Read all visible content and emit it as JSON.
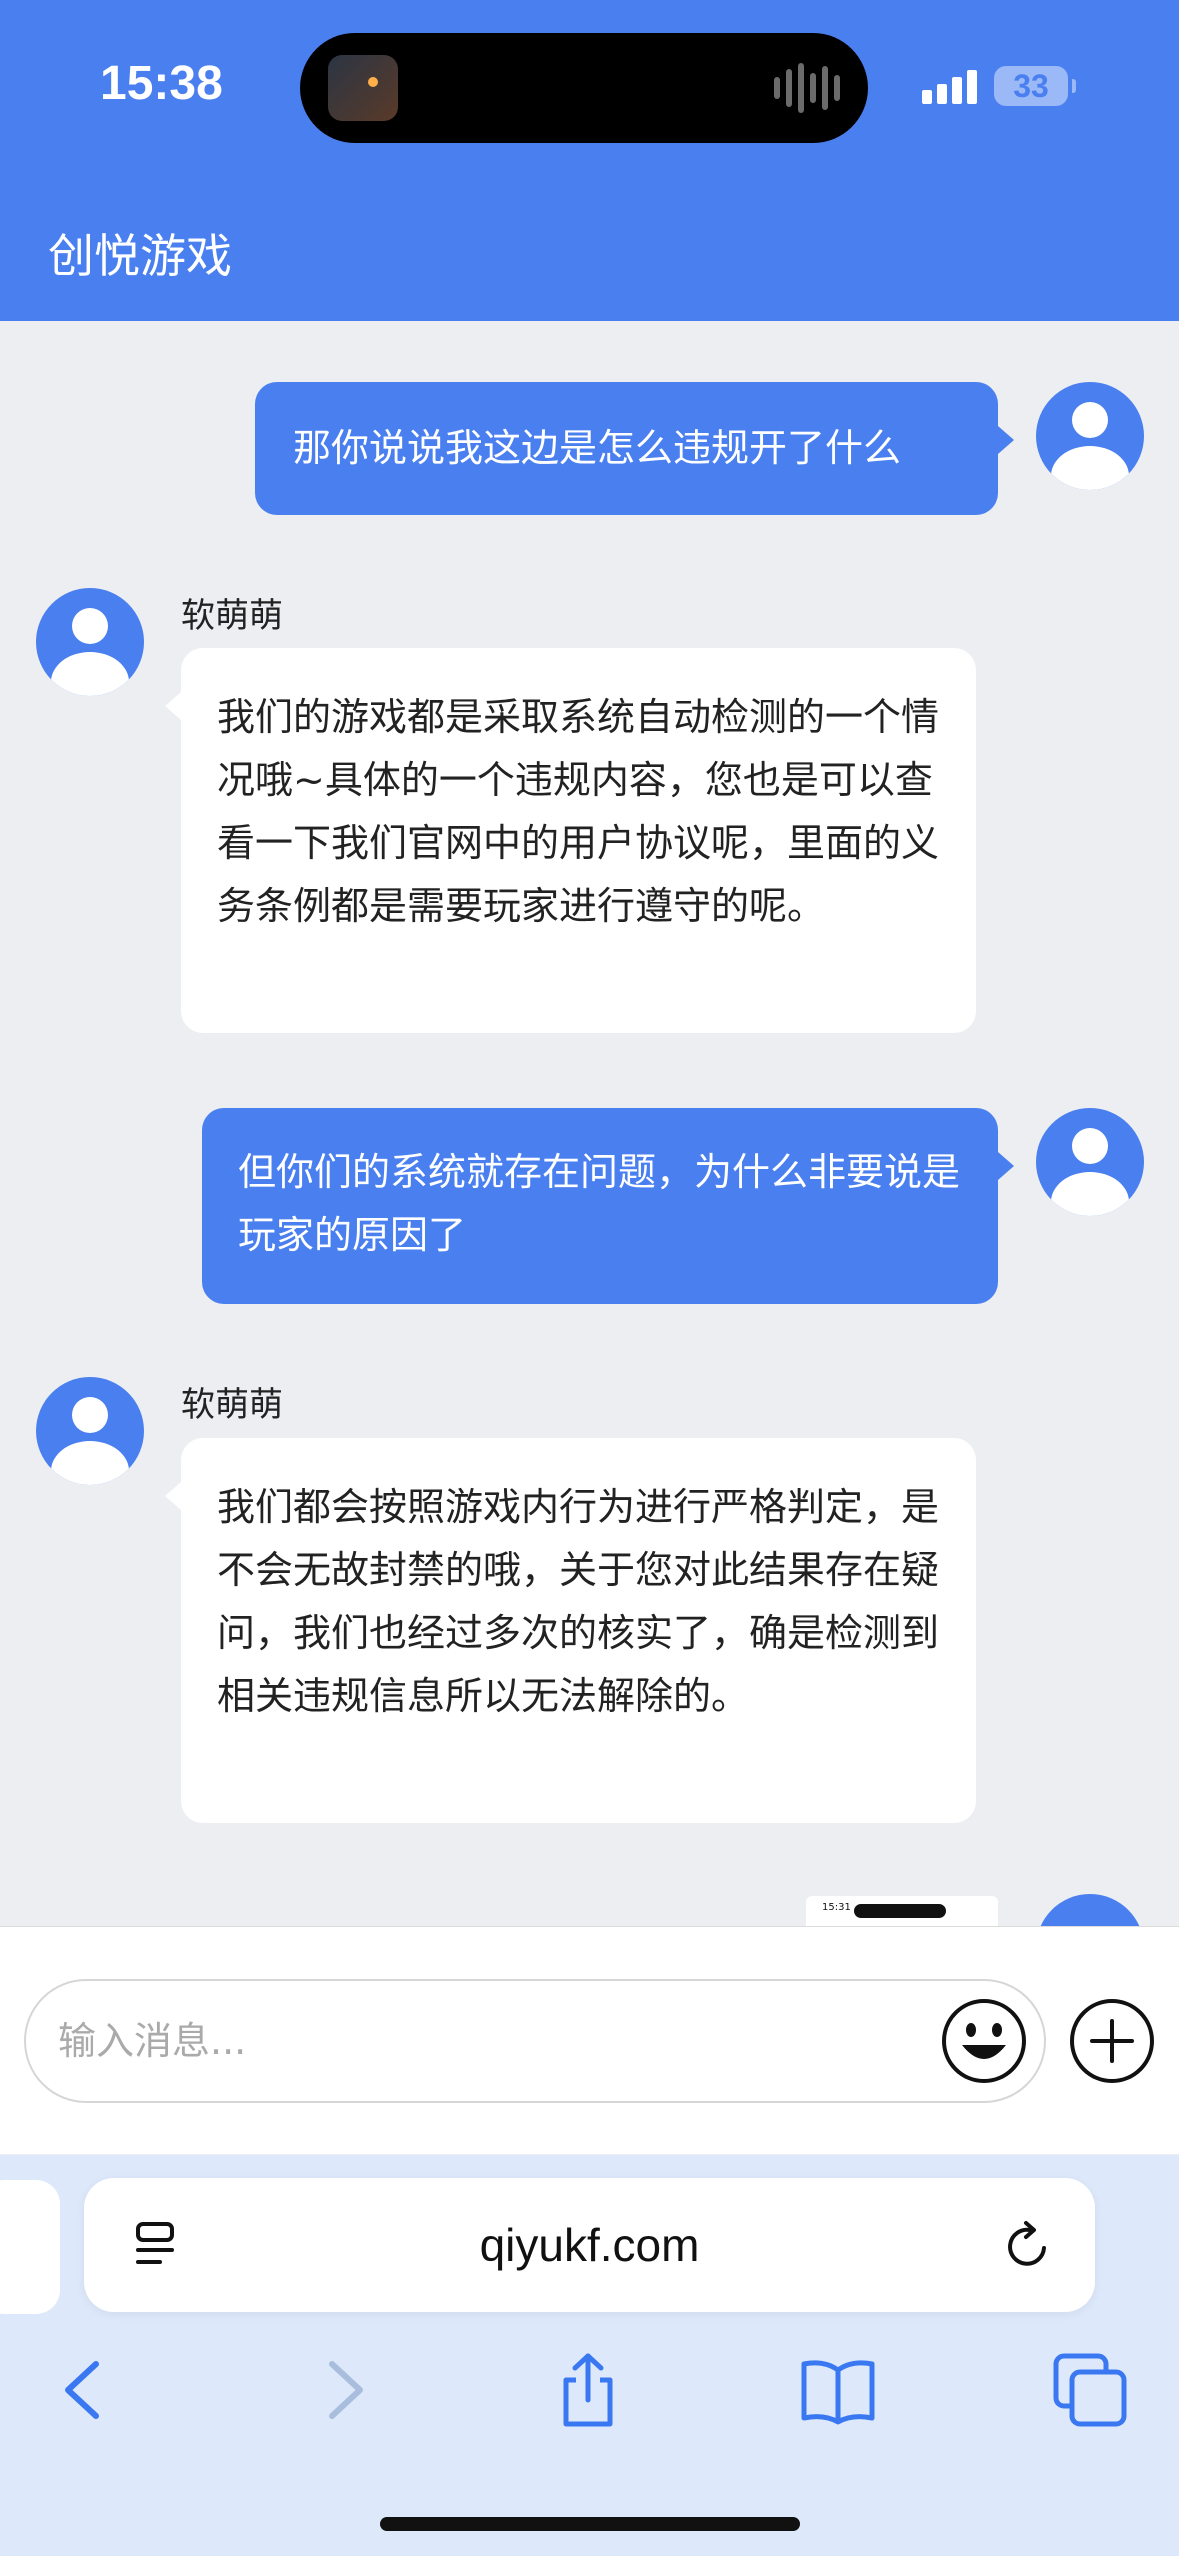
{
  "status_bar": {
    "time": "15:38",
    "battery": "33"
  },
  "header": {
    "title": "创悦游戏"
  },
  "messages": [
    {
      "role": "user",
      "text": "那你说说我这边是怎么违规开了什么"
    },
    {
      "role": "agent",
      "sender": "软萌萌",
      "text": "我们的游戏都是采取系统自动检测的一个情况哦~具体的一个违规内容，您也是可以查看一下我们官网中的用户协议呢，里面的义务条例都是需要玩家进行遵守的呢。"
    },
    {
      "role": "user",
      "text": "但你们的系统就存在问题，为什么非要说是玩家的原因了"
    },
    {
      "role": "agent",
      "sender": "软萌萌",
      "text": "我们都会按照游戏内行为进行严格判定，是不会无故封禁的哦，关于您对此结果存在疑问，我们也经过多次的核实了，确是检测到相关违规信息所以无法解除的。"
    }
  ],
  "partial_thumb_time": "15:31",
  "input": {
    "placeholder": "输入消息..."
  },
  "browser": {
    "url": "qiyukf.com"
  },
  "icons": {
    "emoji": "emoji-icon",
    "add": "plus-circle-icon",
    "reader": "reader-icon",
    "reload": "reload-icon",
    "back": "chevron-left-icon",
    "forward": "chevron-right-icon",
    "share": "share-icon",
    "bookmarks": "book-icon",
    "tabs": "tabs-icon"
  },
  "colors": {
    "accent": "#4a7ff0",
    "background": "#eceef2",
    "toolbar": "#dde9fb"
  }
}
